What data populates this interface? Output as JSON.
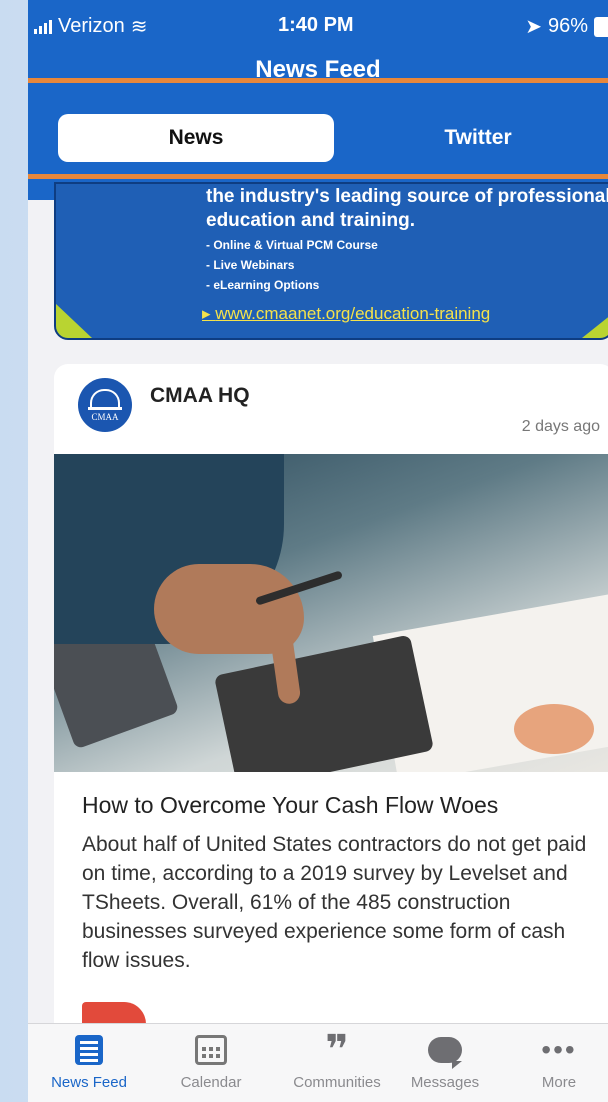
{
  "status_bar": {
    "carrier": "Verizon",
    "time": "1:40 PM",
    "battery": "96%"
  },
  "nav": {
    "title": "News Feed"
  },
  "segments": [
    {
      "label": "News",
      "active": true
    },
    {
      "label": "Twitter",
      "active": false
    }
  ],
  "banner": {
    "line1": "the industry's leading source of professional",
    "line2": "education and training.",
    "bullets": [
      "- Online & Virtual PCM Course",
      "- Live Webinars",
      "- eLearning Options"
    ],
    "link": "www.cmaanet.org/education-training"
  },
  "post": {
    "author": "CMAA HQ",
    "avatar_text": "CMAA",
    "time_ago": "2 days ago",
    "title": "How to Overcome Your Cash Flow Woes",
    "excerpt": "About half of United States contractors do not get paid on time, according to a 2019 survey by Levelset and TSheets. Overall, 61% of the 485 construction businesses surveyed experience some form of cash flow issues."
  },
  "tabbar": {
    "items": [
      {
        "label": "News Feed",
        "icon": "news-feed-icon",
        "active": true
      },
      {
        "label": "Calendar",
        "icon": "calendar-icon",
        "active": false
      },
      {
        "label": "Communities",
        "icon": "quote-icon",
        "active": false
      },
      {
        "label": "Messages",
        "icon": "chat-bubble-icon",
        "active": false
      },
      {
        "label": "More",
        "icon": "more-icon",
        "active": false
      }
    ]
  },
  "colors": {
    "brand_blue": "#1a66c8",
    "highlight": "#e8873a",
    "accent_green": "#b9d431",
    "link_yellow": "#f5e24a"
  }
}
